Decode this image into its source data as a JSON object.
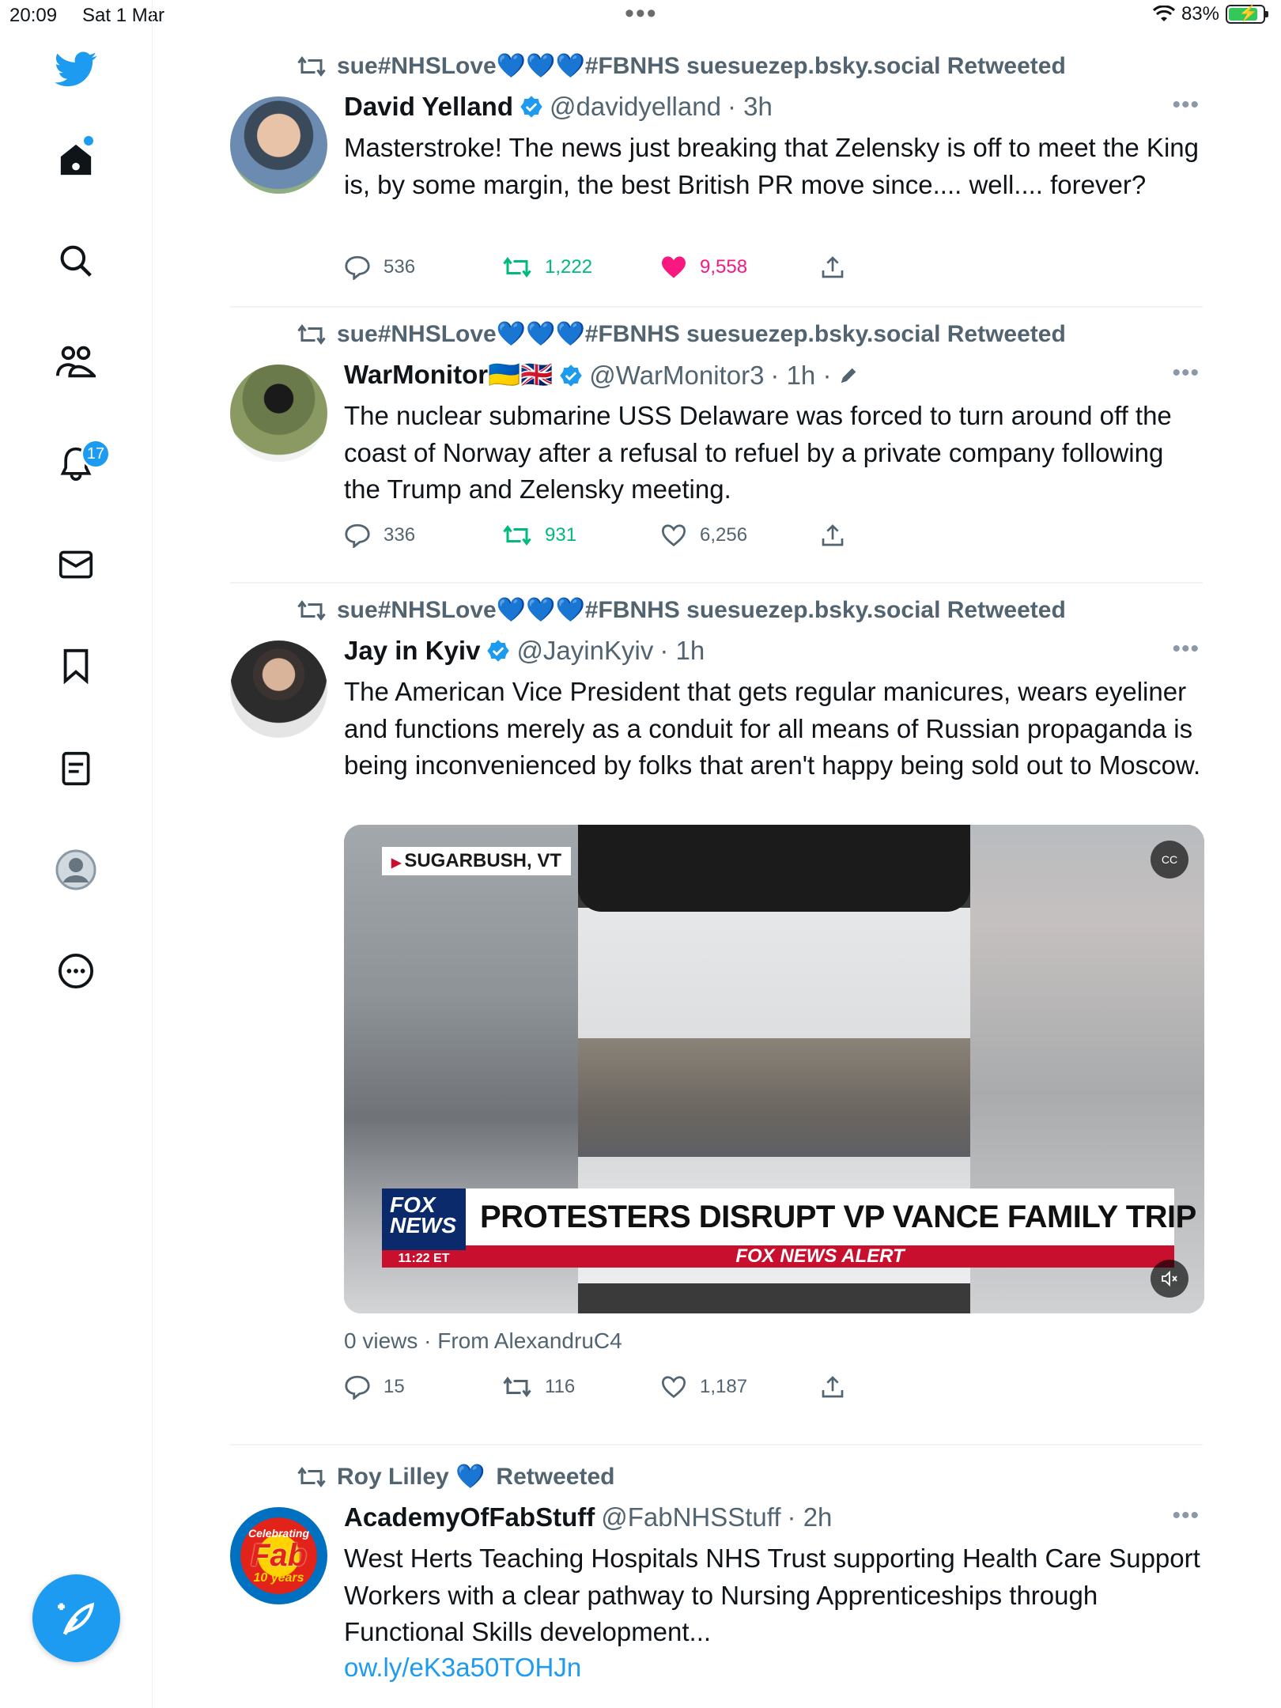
{
  "status_bar": {
    "time": "20:09",
    "date": "Sat 1 Mar",
    "battery": "83%"
  },
  "sidebar": {
    "notifications_badge": "17",
    "items": [
      "home",
      "search",
      "communities",
      "notifications",
      "messages",
      "bookmarks",
      "lists",
      "profile",
      "more"
    ]
  },
  "tweets": [
    {
      "retweeted_by": "sue#NHSLove💙💙💙#FBNHS suesuezep.bsky.social Retweeted",
      "name": "David Yelland",
      "handle": "@davidyelland",
      "time": "· 3h",
      "text": "Masterstroke! The news just breaking that Zelensky is off to meet the King is, by some margin, the best British PR move since.... well.... forever?",
      "replies": "536",
      "retweets": "1,222",
      "likes": "9,558"
    },
    {
      "retweeted_by": "sue#NHSLove💙💙💙#FBNHS suesuezep.bsky.social Retweeted",
      "name": "WarMonitor🇺🇦🇬🇧",
      "handle": "@WarMonitor3",
      "time": "· 1h ·",
      "text": "The nuclear submarine USS Delaware was forced to turn around off the coast of Norway after a refusal to refuel by a private company following the Trump and Zelensky meeting.",
      "replies": "336",
      "retweets": "931",
      "likes": "6,256"
    },
    {
      "retweeted_by": "sue#NHSLove💙💙💙#FBNHS suesuezep.bsky.social Retweeted",
      "name": "Jay in Kyiv",
      "handle": "@JayinKyiv",
      "time": "· 1h",
      "text": "The American Vice President that gets regular manicures, wears eyeliner and functions merely as a conduit for all means of Russian propaganda is being inconvenienced by folks that aren't happy being sold out to Moscow.",
      "media": {
        "location": "SUGARBUSH, VT",
        "logo_line1": "FOX",
        "logo_line2": "NEWS",
        "logo_time": "11:22 ET",
        "headline": "PROTESTERS DISRUPT VP VANCE FAMILY TRIP IN VT",
        "alert": "FOX NEWS ALERT",
        "cc": "CC"
      },
      "views": "0 views · From AlexandruC4",
      "replies": "15",
      "retweets": "116",
      "likes": "1,187"
    },
    {
      "retweeted_by_name": "Roy Lilley 💙",
      "retweeted_suffix": "Retweeted",
      "name": "AcademyOfFabStuff",
      "handle": "@FabNHSStuff",
      "time": "· 2h",
      "avatar_text_top": "Celebrating",
      "avatar_text_mid": "Fab",
      "avatar_text_bottom": "10 years",
      "text": "West Herts Teaching Hospitals NHS Trust supporting Health Care Support Workers with a clear pathway to Nursing Apprenticeships through Functional Skills development...",
      "link": "ow.ly/eK3a50TOHJn"
    }
  ],
  "colors": {
    "accent": "#1d9bf0",
    "retweet": "#00ba7c",
    "like": "#f91880",
    "muted": "#536471"
  }
}
